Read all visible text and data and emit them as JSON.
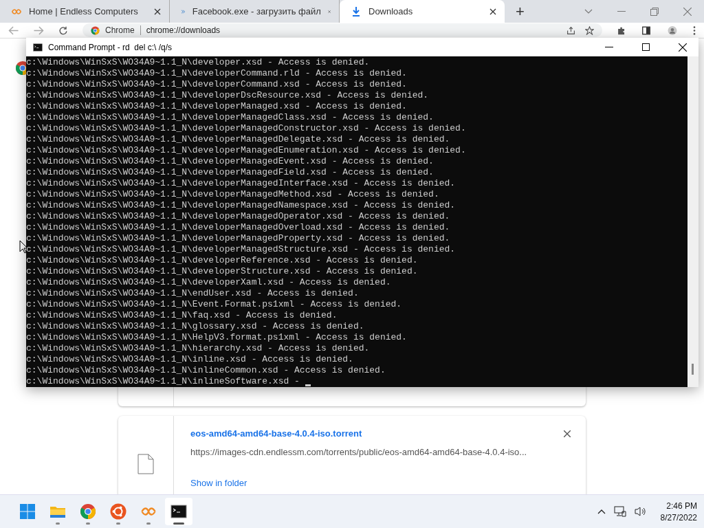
{
  "browser": {
    "tabs": [
      {
        "kind": "endless",
        "title": "Home | Endless Computers",
        "selected": false
      },
      {
        "kind": "chevrons",
        "title": "Facebook.exe - загрузить файл",
        "selected": false
      },
      {
        "kind": "download",
        "title": "Downloads",
        "selected": true
      }
    ],
    "new_tab": "+",
    "address": {
      "site": "Chrome",
      "url": "chrome://downloads"
    },
    "downloads": [
      {
        "filename": "eos-amd64-amd64-base-4.0.4-iso.torrent",
        "url": "https://images-cdn.endlessm.com/torrents/public/eos-amd64-amd64-base-4.0.4-iso...",
        "action": "Show in folder"
      }
    ]
  },
  "console": {
    "title": "Command Prompt - rd  del c:\\ /q/s",
    "lines": [
      "c:\\Windows\\WinSxS\\WO34A9~1.1_N\\developer.xsd - Access is denied.",
      "c:\\Windows\\WinSxS\\WO34A9~1.1_N\\developerCommand.rld - Access is denied.",
      "c:\\Windows\\WinSxS\\WO34A9~1.1_N\\developerCommand.xsd - Access is denied.",
      "c:\\Windows\\WinSxS\\WO34A9~1.1_N\\developerDscResource.xsd - Access is denied.",
      "c:\\Windows\\WinSxS\\WO34A9~1.1_N\\developerManaged.xsd - Access is denied.",
      "c:\\Windows\\WinSxS\\WO34A9~1.1_N\\developerManagedClass.xsd - Access is denied.",
      "c:\\Windows\\WinSxS\\WO34A9~1.1_N\\developerManagedConstructor.xsd - Access is denied.",
      "c:\\Windows\\WinSxS\\WO34A9~1.1_N\\developerManagedDelegate.xsd - Access is denied.",
      "c:\\Windows\\WinSxS\\WO34A9~1.1_N\\developerManagedEnumeration.xsd - Access is denied.",
      "c:\\Windows\\WinSxS\\WO34A9~1.1_N\\developerManagedEvent.xsd - Access is denied.",
      "c:\\Windows\\WinSxS\\WO34A9~1.1_N\\developerManagedField.xsd - Access is denied.",
      "c:\\Windows\\WinSxS\\WO34A9~1.1_N\\developerManagedInterface.xsd - Access is denied.",
      "c:\\Windows\\WinSxS\\WO34A9~1.1_N\\developerManagedMethod.xsd - Access is denied.",
      "c:\\Windows\\WinSxS\\WO34A9~1.1_N\\developerManagedNamespace.xsd - Access is denied.",
      "c:\\Windows\\WinSxS\\WO34A9~1.1_N\\developerManagedOperator.xsd - Access is denied.",
      "c:\\Windows\\WinSxS\\WO34A9~1.1_N\\developerManagedOverload.xsd - Access is denied.",
      "c:\\Windows\\WinSxS\\WO34A9~1.1_N\\developerManagedProperty.xsd - Access is denied.",
      "c:\\Windows\\WinSxS\\WO34A9~1.1_N\\developerManagedStructure.xsd - Access is denied.",
      "c:\\Windows\\WinSxS\\WO34A9~1.1_N\\developerReference.xsd - Access is denied.",
      "c:\\Windows\\WinSxS\\WO34A9~1.1_N\\developerStructure.xsd - Access is denied.",
      "c:\\Windows\\WinSxS\\WO34A9~1.1_N\\developerXaml.xsd - Access is denied.",
      "c:\\Windows\\WinSxS\\WO34A9~1.1_N\\endUser.xsd - Access is denied.",
      "c:\\Windows\\WinSxS\\WO34A9~1.1_N\\Event.Format.ps1xml - Access is denied.",
      "c:\\Windows\\WinSxS\\WO34A9~1.1_N\\faq.xsd - Access is denied.",
      "c:\\Windows\\WinSxS\\WO34A9~1.1_N\\glossary.xsd - Access is denied.",
      "c:\\Windows\\WinSxS\\WO34A9~1.1_N\\HelpV3.format.ps1xml - Access is denied.",
      "c:\\Windows\\WinSxS\\WO34A9~1.1_N\\hierarchy.xsd - Access is denied.",
      "c:\\Windows\\WinSxS\\WO34A9~1.1_N\\inline.xsd - Access is denied.",
      "c:\\Windows\\WinSxS\\WO34A9~1.1_N\\inlineCommon.xsd - Access is denied.",
      "c:\\Windows\\WinSxS\\WO34A9~1.1_N\\inlineSoftware.xsd -"
    ]
  },
  "taskbar": {
    "apps": [
      {
        "kind": "start",
        "active": false
      },
      {
        "kind": "folder",
        "active": false
      },
      {
        "kind": "chrome",
        "active": false
      },
      {
        "kind": "ubuntu",
        "active": false
      },
      {
        "kind": "endless",
        "active": false
      },
      {
        "kind": "terminal",
        "active": true
      }
    ],
    "time": "2:46 PM",
    "date": "8/27/2022"
  }
}
